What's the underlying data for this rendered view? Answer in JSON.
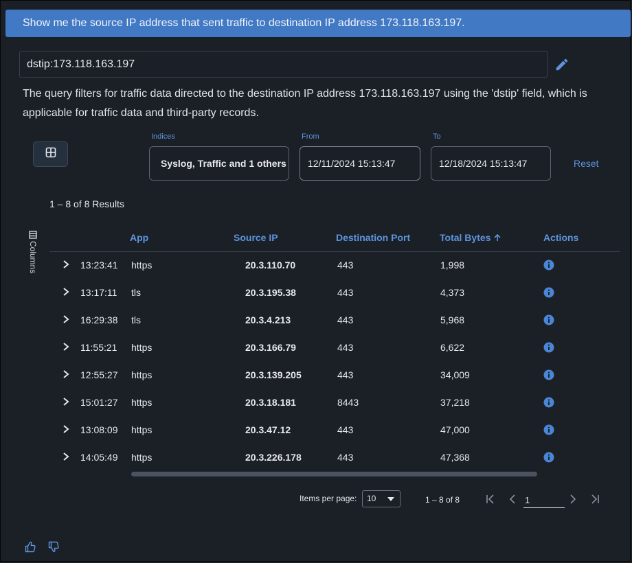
{
  "banner": {
    "prompt": "Show me the source IP address that sent traffic to destination IP address 173.118.163.197."
  },
  "query": {
    "value": "dstip:173.118.163.197"
  },
  "explanation": "The query filters for traffic data directed to the destination IP address 173.118.163.197 using the 'dstip' field, which is applicable for traffic data and third-party records.",
  "filters": {
    "indices_label": "Indices",
    "indices_value": "Syslog, Traffic and 1 others",
    "from_label": "From",
    "from_value": "12/11/2024 15:13:47",
    "to_label": "To",
    "to_value": "12/18/2024 15:13:47",
    "reset_label": "Reset"
  },
  "results_count": "1 – 8 of 8 Results",
  "columns_label": "Columns",
  "table": {
    "headers": {
      "app": "App",
      "source_ip": "Source IP",
      "dest_port": "Destination Port",
      "total_bytes": "Total Bytes",
      "actions": "Actions"
    },
    "sort": {
      "column": "total_bytes",
      "direction": "ascending"
    },
    "rows": [
      {
        "time": "13:23:41",
        "app": "https",
        "source_ip": "20.3.110.70",
        "dest_port": "443",
        "total_bytes": "1,998"
      },
      {
        "time": "13:17:11",
        "app": "tls",
        "source_ip": "20.3.195.38",
        "dest_port": "443",
        "total_bytes": "4,373"
      },
      {
        "time": "16:29:38",
        "app": "tls",
        "source_ip": "20.3.4.213",
        "dest_port": "443",
        "total_bytes": "5,968"
      },
      {
        "time": "11:55:21",
        "app": "https",
        "source_ip": "20.3.166.79",
        "dest_port": "443",
        "total_bytes": "6,622"
      },
      {
        "time": "12:55:27",
        "app": "https",
        "source_ip": "20.3.139.205",
        "dest_port": "443",
        "total_bytes": "34,009"
      },
      {
        "time": "15:01:27",
        "app": "https",
        "source_ip": "20.3.18.181",
        "dest_port": "8443",
        "total_bytes": "37,218"
      },
      {
        "time": "13:08:09",
        "app": "https",
        "source_ip": "20.3.47.12",
        "dest_port": "443",
        "total_bytes": "47,000"
      },
      {
        "time": "14:05:49",
        "app": "https",
        "source_ip": "20.3.226.178",
        "dest_port": "443",
        "total_bytes": "47,368"
      }
    ]
  },
  "pagination": {
    "items_per_page_label": "Items per page:",
    "items_per_page_value": "10",
    "range": "1 – 8 of 8",
    "page": "1"
  },
  "colors": {
    "accent": "#5c95de",
    "banner": "#4279c4",
    "background": "#1b1f26",
    "info_icon": "#4a86d6"
  },
  "icons": {
    "edit": "pencil-icon",
    "grid": "table-grid-icon",
    "expand": "chevron-right-icon",
    "info": "info-icon",
    "sort": "arrow-up-icon",
    "columns": "columns-icon",
    "first": "first-page-icon",
    "prev": "chevron-left-icon",
    "next": "chevron-right-icon",
    "last": "last-page-icon",
    "like": "thumbs-up-icon",
    "dislike": "thumbs-down-icon"
  }
}
